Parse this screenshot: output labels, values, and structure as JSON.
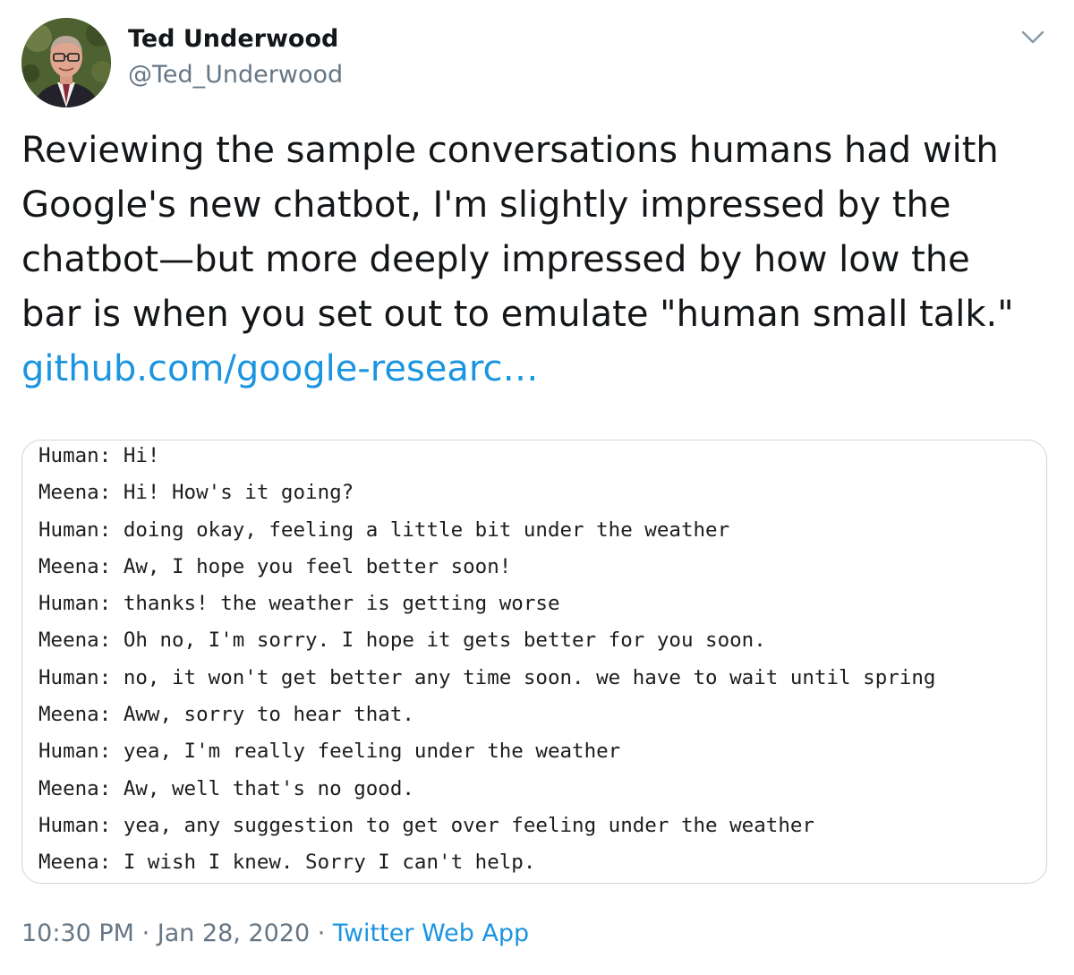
{
  "author": {
    "name": "Ted Underwood",
    "handle": "@Ted_Underwood"
  },
  "tweet": {
    "text_lines": [
      "Reviewing the sample conversations humans had with",
      "Google's new chatbot, I'm slightly impressed by the",
      "chatbot—but more deeply impressed by how low the",
      "bar is when you set out to emulate \"human small talk.\""
    ],
    "link": "github.com/google-researc…"
  },
  "media": {
    "transcript": [
      {
        "speaker": "Human:",
        "text": "Hi!"
      },
      {
        "speaker": "Meena:",
        "text": "Hi! How's it going?"
      },
      {
        "speaker": "Human:",
        "text": "doing okay, feeling a little bit under the weather"
      },
      {
        "speaker": "Meena:",
        "text": "Aw, I hope you feel better soon!"
      },
      {
        "speaker": "Human:",
        "text": "thanks! the weather is getting worse"
      },
      {
        "speaker": "Meena:",
        "text": "Oh no, I'm sorry. I hope it gets better for you soon."
      },
      {
        "speaker": "Human:",
        "text": "no, it won't get better any time soon. we have to wait until spring"
      },
      {
        "speaker": "Meena:",
        "text": "Aww, sorry to hear that."
      },
      {
        "speaker": "Human:",
        "text": "yea, I'm really feeling under the weather"
      },
      {
        "speaker": "Meena:",
        "text": "Aw, well that's no good."
      },
      {
        "speaker": "Human:",
        "text": "yea, any suggestion to get over feeling under the weather"
      },
      {
        "speaker": "Meena:",
        "text": "I wish I knew. Sorry I can't help."
      }
    ]
  },
  "meta": {
    "time": "10:30 PM",
    "separator": " · ",
    "date": "Jan 28, 2020",
    "source": "Twitter Web App"
  },
  "icons": {
    "menu": "chevron-down-icon",
    "avatar": "profile-photo"
  },
  "colors": {
    "link": "#1b95e0",
    "secondary_text": "#657786",
    "border": "#ccd6dd"
  }
}
